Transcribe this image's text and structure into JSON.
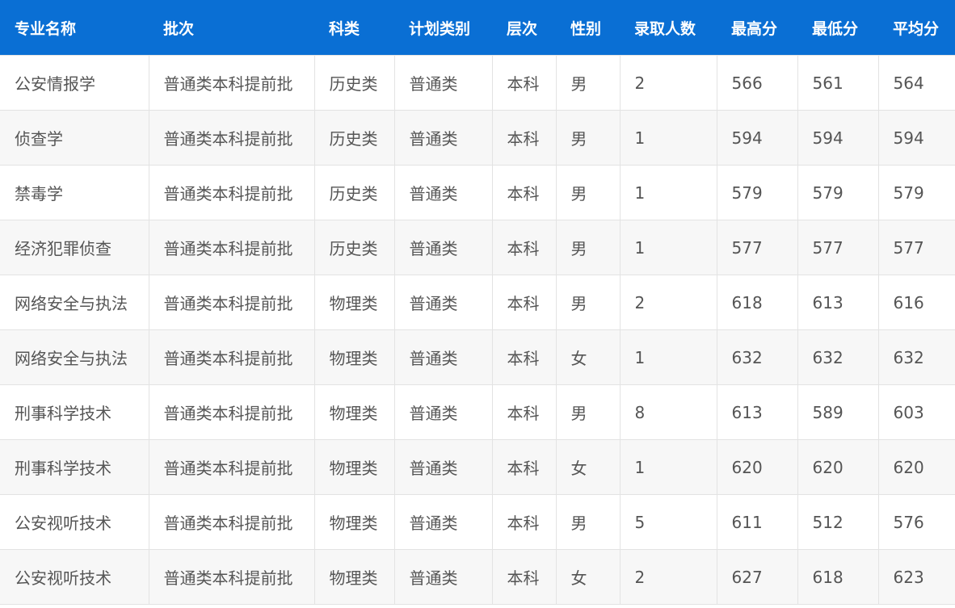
{
  "table": {
    "headers": [
      "专业名称",
      "批次",
      "科类",
      "计划类别",
      "层次",
      "性别",
      "录取人数",
      "最高分",
      "最低分",
      "平均分"
    ],
    "rows": [
      [
        "公安情报学",
        "普通类本科提前批",
        "历史类",
        "普通类",
        "本科",
        "男",
        "2",
        "566",
        "561",
        "564"
      ],
      [
        "侦查学",
        "普通类本科提前批",
        "历史类",
        "普通类",
        "本科",
        "男",
        "1",
        "594",
        "594",
        "594"
      ],
      [
        "禁毒学",
        "普通类本科提前批",
        "历史类",
        "普通类",
        "本科",
        "男",
        "1",
        "579",
        "579",
        "579"
      ],
      [
        "经济犯罪侦查",
        "普通类本科提前批",
        "历史类",
        "普通类",
        "本科",
        "男",
        "1",
        "577",
        "577",
        "577"
      ],
      [
        "网络安全与执法",
        "普通类本科提前批",
        "物理类",
        "普通类",
        "本科",
        "男",
        "2",
        "618",
        "613",
        "616"
      ],
      [
        "网络安全与执法",
        "普通类本科提前批",
        "物理类",
        "普通类",
        "本科",
        "女",
        "1",
        "632",
        "632",
        "632"
      ],
      [
        "刑事科学技术",
        "普通类本科提前批",
        "物理类",
        "普通类",
        "本科",
        "男",
        "8",
        "613",
        "589",
        "603"
      ],
      [
        "刑事科学技术",
        "普通类本科提前批",
        "物理类",
        "普通类",
        "本科",
        "女",
        "1",
        "620",
        "620",
        "620"
      ],
      [
        "公安视听技术",
        "普通类本科提前批",
        "物理类",
        "普通类",
        "本科",
        "男",
        "5",
        "611",
        "512",
        "576"
      ],
      [
        "公安视听技术",
        "普通类本科提前批",
        "物理类",
        "普通类",
        "本科",
        "女",
        "2",
        "627",
        "618",
        "623"
      ]
    ]
  },
  "colors": {
    "header_bg": "#0a6fd4",
    "header_text": "#ffffff",
    "cell_text": "#555555",
    "stripe_bg": "#f7f7f7",
    "border": "#e3e3e3"
  }
}
